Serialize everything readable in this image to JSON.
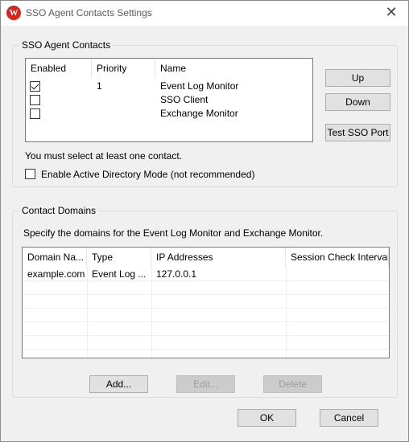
{
  "window": {
    "title": "SSO Agent Contacts Settings",
    "close_glyph": "✕",
    "icon": "watchguard-icon",
    "icon_letter": "W"
  },
  "sso_group": {
    "label": "SSO Agent Contacts",
    "columns": [
      "Enabled",
      "Priority",
      "Name"
    ],
    "rows": [
      {
        "enabled": true,
        "priority": "1",
        "name": "Event Log Monitor"
      },
      {
        "enabled": false,
        "priority": "",
        "name": "SSO Client"
      },
      {
        "enabled": false,
        "priority": "",
        "name": "Exchange Monitor"
      }
    ],
    "up_label": "Up",
    "down_label": "Down",
    "test_label": "Test SSO Port",
    "hint": "You must select at least one contact.",
    "ad_mode_label": "Enable Active Directory Mode (not recommended)",
    "ad_mode_checked": false
  },
  "domains_group": {
    "label": "Contact Domains",
    "description": "Specify the domains for the Event Log Monitor and Exchange Monitor.",
    "columns": [
      "Domain Na...",
      "Type",
      "IP Addresses",
      "Session Check Interval"
    ],
    "rows": [
      {
        "domain": "example.com",
        "type": "Event Log ...",
        "ip": "127.0.0.1",
        "interval": ""
      }
    ],
    "add_label": "Add...",
    "edit_label": "Edit...",
    "delete_label": "Delete"
  },
  "footer": {
    "ok_label": "OK",
    "cancel_label": "Cancel"
  },
  "colors": {
    "accent_icon": "#d9261c",
    "window_bg": "#f0f0f0"
  }
}
